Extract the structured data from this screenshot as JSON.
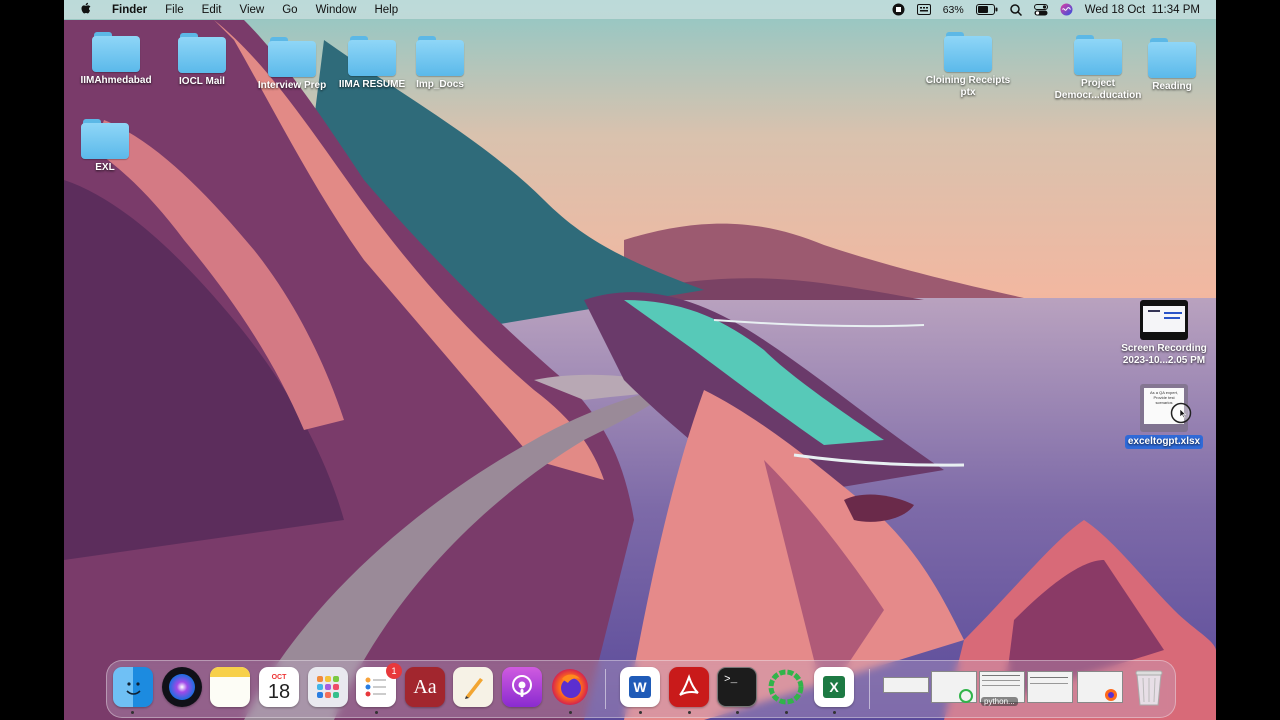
{
  "menubar": {
    "apple": "",
    "app_name": "Finder",
    "menus": [
      "File",
      "Edit",
      "View",
      "Go",
      "Window",
      "Help"
    ],
    "battery": "63%",
    "datetime": "Wed 18 Oct  11:34 PM"
  },
  "desktop": {
    "icons": [
      {
        "label": "IIMAhmedabad",
        "type": "folder"
      },
      {
        "label": "IOCL Mail",
        "type": "folder"
      },
      {
        "label": "Interview Prep",
        "type": "folder"
      },
      {
        "label": "IIMA RESUME",
        "type": "folder"
      },
      {
        "label": "Imp_Docs",
        "type": "folder"
      },
      {
        "label": "EXL",
        "type": "folder"
      },
      {
        "label": "Cloining Receipts",
        "label2": "ptx",
        "type": "folder"
      },
      {
        "label": "Project",
        "label2": "Democr...ducation",
        "type": "folder"
      },
      {
        "label": "Reading",
        "type": "folder"
      },
      {
        "label": "Screen Recording",
        "label2": "2023-10...2.05 PM",
        "type": "video"
      },
      {
        "label": "exceltogpt.xlsx",
        "type": "document",
        "selected": true
      }
    ],
    "doc_thumb_text": "As a QA expert, Provide test scenarios"
  },
  "dock": {
    "calendar_month": "OCT",
    "calendar_day": "18",
    "reminders_badge": "1",
    "dictionary_glyph": "Aa",
    "word_glyph": "W",
    "excel_glyph": "X",
    "terminal_glyph": ">_",
    "stack_label": "python..."
  },
  "colors": {
    "accent": "#2f6ad8",
    "folder": "#6cc4ef"
  }
}
